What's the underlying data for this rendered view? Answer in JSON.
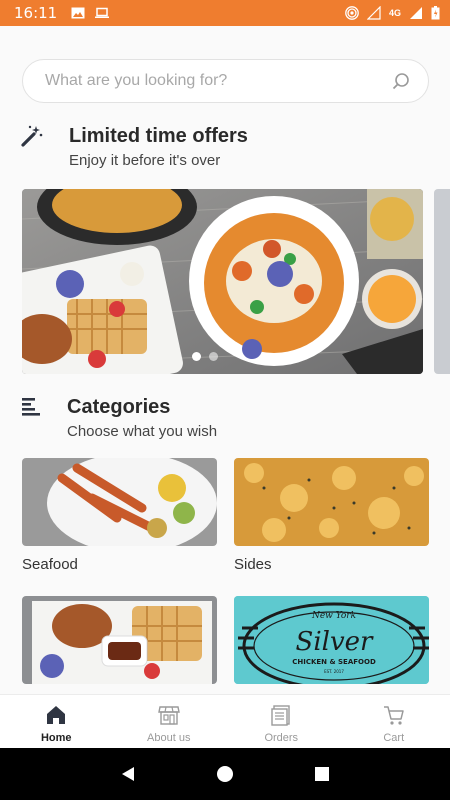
{
  "status_bar": {
    "time": "16:11",
    "network": "4G",
    "network_sub": "LTE",
    "background_color": "#ef7d2f"
  },
  "search": {
    "placeholder": "What are you looking for?",
    "icon": "search-icon"
  },
  "offers": {
    "title": "Limited time offers",
    "subtitle": "Enjoy it before it's over",
    "icon": "magic-wand-icon",
    "carousel_dots": 2,
    "active_dot": 0
  },
  "categories": {
    "title": "Categories",
    "subtitle": "Choose what you wish",
    "icon": "list-icon",
    "items": [
      {
        "label": "Seafood"
      },
      {
        "label": "Sides"
      }
    ]
  },
  "banner": {
    "line1": "New York",
    "line2": "Silver",
    "line3": "CHICKEN & SEAFOOD",
    "line4": "EST. 2017",
    "color": "#5ec9cf"
  },
  "bottom_nav": {
    "items": [
      {
        "label": "Home",
        "icon": "home-icon",
        "active": true
      },
      {
        "label": "About us",
        "icon": "store-icon",
        "active": false
      },
      {
        "label": "Orders",
        "icon": "orders-icon",
        "active": false
      },
      {
        "label": "Cart",
        "icon": "cart-icon",
        "active": false
      }
    ]
  }
}
